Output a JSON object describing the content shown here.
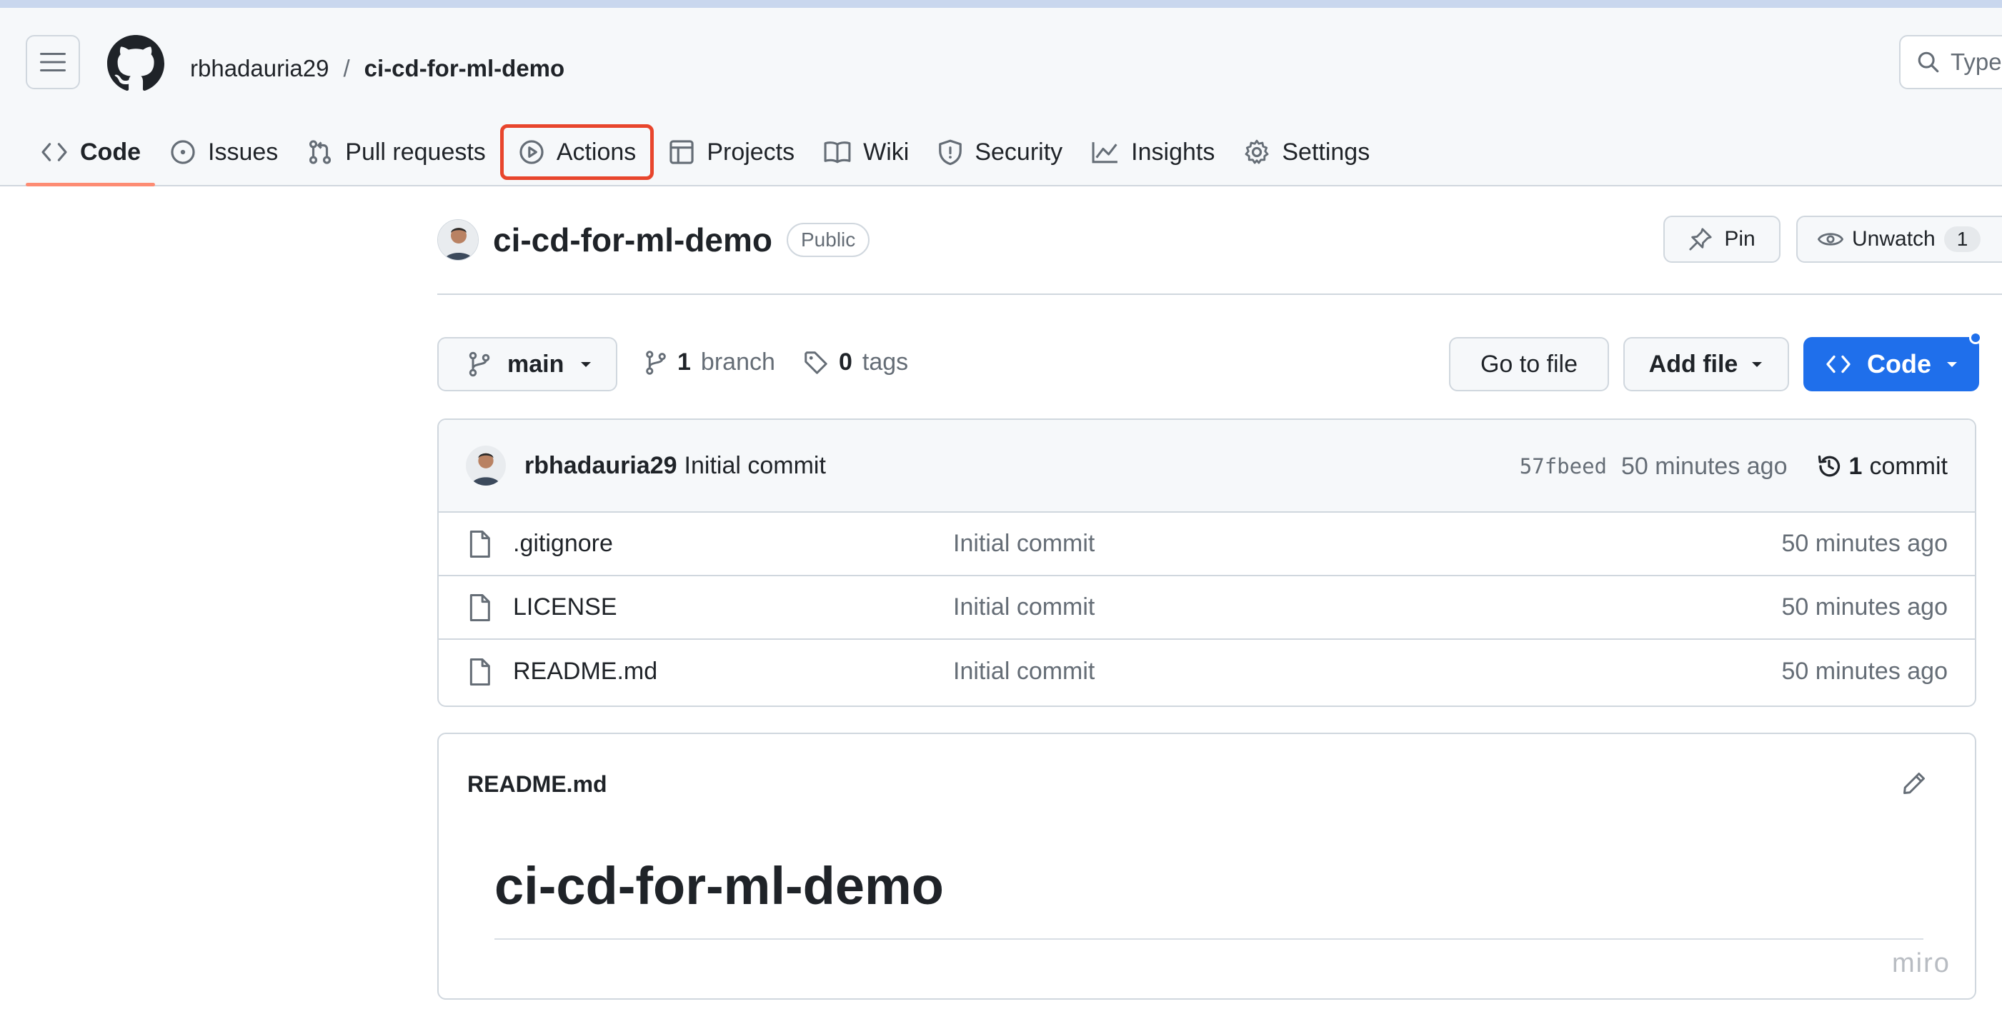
{
  "header": {
    "owner": "rbhadauria29",
    "separator": "/",
    "repo": "ci-cd-for-ml-demo",
    "search_placeholder": "Type"
  },
  "tabs": [
    {
      "label": "Code",
      "icon": "code-icon",
      "selected": true
    },
    {
      "label": "Issues",
      "icon": "issue-icon"
    },
    {
      "label": "Pull requests",
      "icon": "pull-request-icon"
    },
    {
      "label": "Actions",
      "icon": "play-icon",
      "highlighted": true
    },
    {
      "label": "Projects",
      "icon": "table-icon"
    },
    {
      "label": "Wiki",
      "icon": "book-icon"
    },
    {
      "label": "Security",
      "icon": "shield-icon"
    },
    {
      "label": "Insights",
      "icon": "graph-icon"
    },
    {
      "label": "Settings",
      "icon": "gear-icon"
    }
  ],
  "repo_header": {
    "name": "ci-cd-for-ml-demo",
    "visibility": "Public",
    "pin_label": "Pin",
    "watch_label": "Unwatch",
    "watch_count": "1"
  },
  "branch_bar": {
    "branch": "main",
    "branch_count": "1",
    "branch_word": "branch",
    "tag_count": "0",
    "tag_word": "tags",
    "goto_label": "Go to file",
    "addfile_label": "Add file",
    "code_label": "Code"
  },
  "latest_commit": {
    "author": "rbhadauria29",
    "message": "Initial commit",
    "sha": "57fbeed",
    "time": "50 minutes ago",
    "count": "1",
    "count_word": "commit"
  },
  "files": [
    {
      "name": ".gitignore",
      "message": "Initial commit",
      "age": "50 minutes ago"
    },
    {
      "name": "LICENSE",
      "message": "Initial commit",
      "age": "50 minutes ago"
    },
    {
      "name": "README.md",
      "message": "Initial commit",
      "age": "50 minutes ago"
    }
  ],
  "readme": {
    "filename": "README.md",
    "heading": "ci-cd-for-ml-demo",
    "watermark": "miro"
  },
  "colors": {
    "accent_blue": "#1f6feb",
    "highlight_red": "#e8452c",
    "tab_underline": "#fd8c73",
    "border": "#d0d7de"
  }
}
